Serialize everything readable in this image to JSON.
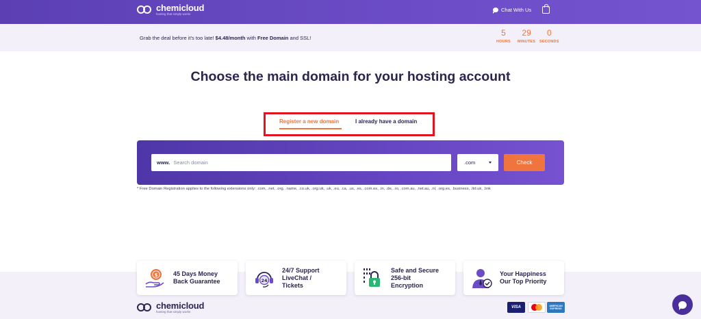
{
  "header": {
    "brand_name": "chemicloud",
    "brand_tagline": "hosting that simply works",
    "chat_label": "Chat With Us",
    "chat_icon": "chat-bubble-icon",
    "cart_icon": "cart-icon"
  },
  "promo": {
    "text_before": "Grab the deal before it's too late! ",
    "price": "$4.48/month",
    "text_mid": " with ",
    "free_domain": "Free Domain",
    "text_after": " and SSL!",
    "countdown": [
      {
        "value": "5",
        "label": "HOURS"
      },
      {
        "value": "29",
        "label": "MINUTES"
      },
      {
        "value": "0",
        "label": "SECONDS"
      }
    ]
  },
  "main": {
    "title": "Choose the main domain for your hosting account",
    "tabs": [
      {
        "label": "Register a new domain",
        "active": true
      },
      {
        "label": "I already have a domain",
        "active": false
      }
    ],
    "search": {
      "prefix": "www.",
      "placeholder": "Search domain",
      "value": "",
      "tld": ".com",
      "button_label": "Check"
    },
    "footnote": "* Free Domain Registration applies to the following extensions only: .com, .net, .org, .name, .co.uk, .org.uk, .uk, .eu, .ca, .us, .es, .com.es, .in, .de, .ro, .com.au, .net.au, .nl, .org.es, .business, .ltd.uk, .link"
  },
  "features": [
    {
      "line1": "45 Days Money",
      "line2": "Back Guarantee",
      "line3": "",
      "icon": "money-back-icon"
    },
    {
      "line1": "24/7 Support",
      "line2": "LiveChat /",
      "line3": "Tickets",
      "icon": "support-headset-icon"
    },
    {
      "line1": "Safe and Secure",
      "line2": "256-bit",
      "line3": "Encryption",
      "icon": "lock-icon"
    },
    {
      "line1": "Your Happiness",
      "line2": "Our Top Priority",
      "line3": "",
      "icon": "happy-agent-icon"
    }
  ],
  "footer": {
    "brand_name": "chemicloud",
    "brand_tagline": "hosting that simply works",
    "payments": [
      {
        "name": "VISA",
        "icon": "visa-icon"
      },
      {
        "name": "Mastercard",
        "icon": "mastercard-icon"
      },
      {
        "name": "AMERICAN EXPRESS",
        "icon": "amex-icon"
      }
    ]
  },
  "colors": {
    "brand_purple": "#5b3fb3",
    "accent_orange": "#f0743e",
    "highlight_red": "#e2141f",
    "text_dark": "#2b2550"
  }
}
